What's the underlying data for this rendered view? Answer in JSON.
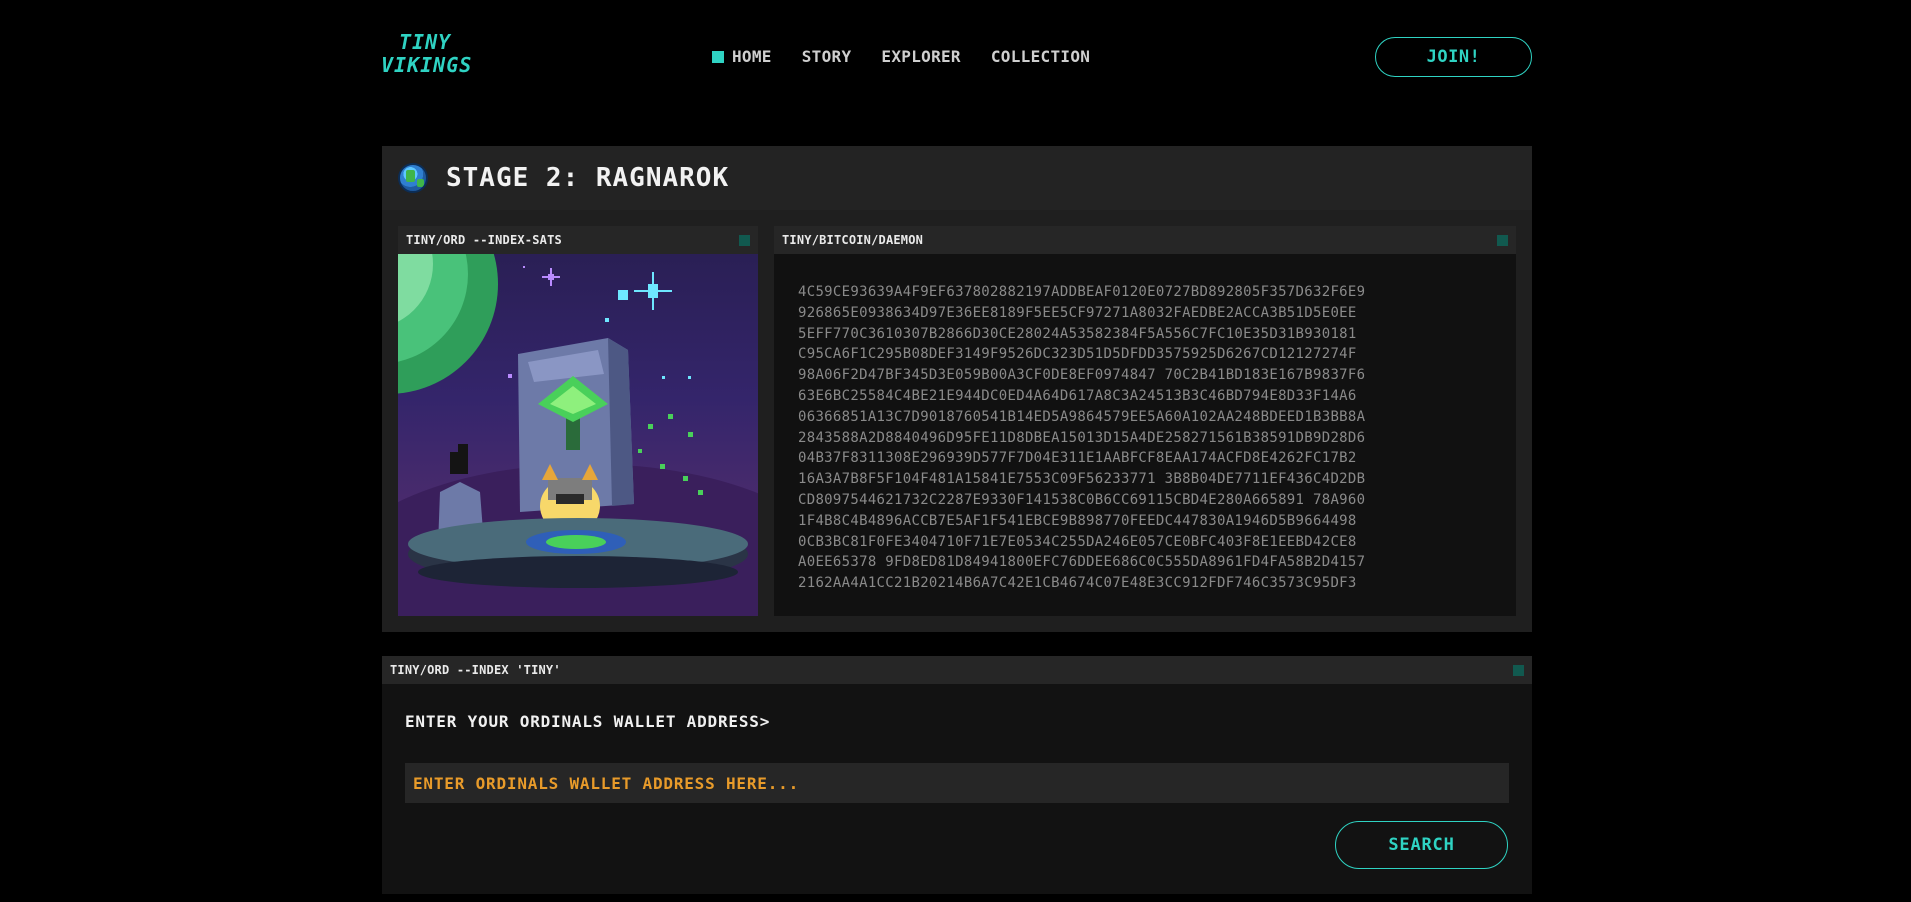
{
  "header": {
    "logo_line1": "TINY",
    "logo_line2": "VIKINGS",
    "nav": [
      {
        "label": "HOME",
        "active": true
      },
      {
        "label": "STORY"
      },
      {
        "label": "EXPLORER"
      },
      {
        "label": "COLLECTION"
      }
    ],
    "join_label": "JOIN!"
  },
  "stage": {
    "icon": "globe-icon",
    "title": "STAGE 2: RAGNAROK",
    "left_pane_title": "TINY/ORD --INDEX-SATS",
    "right_pane_title": "TINY/BITCOIN/DAEMON",
    "hex_lines": [
      "4C59CE93639A4F9EF637802882197ADDBEAF0120E0727BD892805F357D632F6E9",
      "926865E0938634D97E36EE8189F5EE5CF97271A8032FAEDBE2ACCA3B51D5E0EE",
      "5EFF770C3610307B2866D30CE28024A53582384F5A556C7FC10E35D31B930181",
      "C95CA6F1C295B08DEF3149F9526DC323D51D5DFDD3575925D6267CD12127274F",
      "98A06F2D47BF345D3E059B00A3CF0DE8EF0974847 70C2B41BD183E167B9837F6",
      "63E6BC25584C4BE21E944DC0ED4A64D617A8C3A24513B3C46BD794E8D33F14A6",
      "06366851A13C7D9018760541B14ED5A9864579EE5A60A102AA248BDEED1B3BB8A",
      "2843588A2D8840496D95FE11D8DBEA15013D15A4DE258271561B38591DB9D28D6",
      "04B37F8311308E296939D577F7D04E311E1AABFCF8EAA174ACFD8E4262FC17B2",
      "16A3A7B8F5F104F481A15841E7553C09F56233771 3B8B04DE7711EF436C4D2DB",
      "CD8097544621732C2287E9330F141538C0B6CC69115CBD4E280A665891 78A960",
      "1F4B8C4B4896ACCB7E5AF1F541EBCE9B898770FEEDC447830A1946D5B9664498",
      "0CB3BC81F0FE3404710F71E7E0534C255DA246E057CE0BFC403F8E1EEBD42CE8",
      "A0EE65378 9FD8ED81D84941800EFC76DDEE686C0C555DA8961FD4FA58B2D4157",
      "2162AA4A1CC21B20214B6A7C42E1CB4674C07E48E3CC912FDF746C3573C95DF3"
    ]
  },
  "search": {
    "pane_title": "TINY/ORD --INDEX 'TINY'",
    "prompt": "ENTER YOUR ORDINALS WALLET ADDRESS>",
    "placeholder": "ENTER ORDINALS WALLET ADDRESS HERE...",
    "button_label": "SEARCH"
  },
  "colors": {
    "accent": "#2fd3c3",
    "placeholder": "#e89b2a",
    "background": "#000000"
  }
}
